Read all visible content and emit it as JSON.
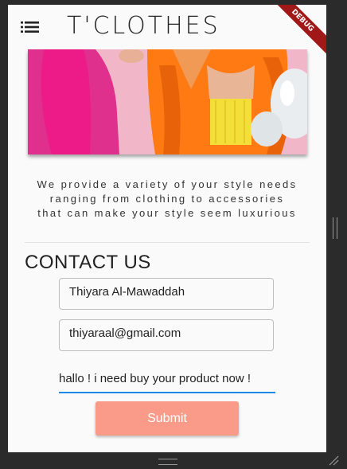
{
  "app": {
    "title": "T'CLOTHES",
    "debug_banner": "DEBUG"
  },
  "icons": {
    "menu": "list-menu-icon",
    "resize": "resize-grip-icon",
    "corner": "corner-resize-icon"
  },
  "hero": {
    "alt": "Model wearing pink and orange clothing with balloons"
  },
  "about": {
    "tagline_lines": [
      "We provide a variety of your style needs",
      "ranging from clothing to accessories",
      "that can make your style seem luxurious"
    ]
  },
  "contact": {
    "heading": "CONTACT US",
    "name_value": "Thiyara Al-Mawaddah",
    "email_value": "thiyaraal@gmail.com",
    "message_value": "hallo ! i need buy your product now !",
    "submit_label": "Submit"
  },
  "colors": {
    "accent": "#fa9b8a",
    "focus": "#1e88e5",
    "debug": "#a01818"
  }
}
